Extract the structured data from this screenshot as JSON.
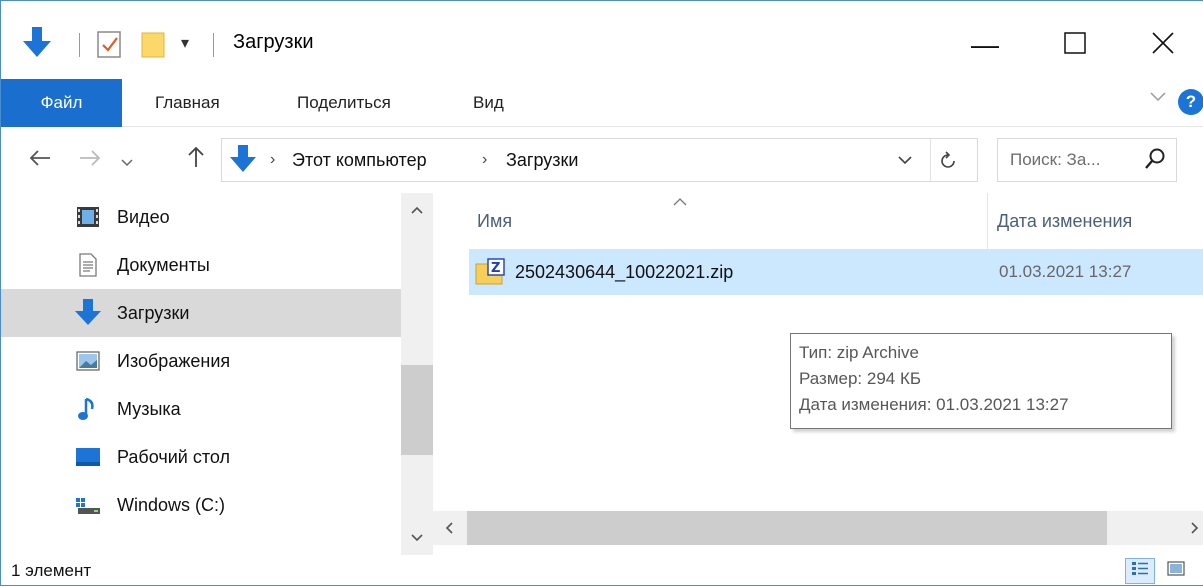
{
  "window": {
    "title": "Загрузки",
    "controls": {
      "minimize": "—",
      "maximize": "☐",
      "close": "✕"
    }
  },
  "ribbon": {
    "tabs": [
      "Файл",
      "Главная",
      "Поделиться",
      "Вид"
    ],
    "help": "?"
  },
  "address": {
    "crumbs": [
      "Этот компьютер",
      "Загрузки"
    ],
    "separator": "›",
    "search_placeholder": "Поиск: За..."
  },
  "nav": {
    "items": [
      {
        "label": "Видео",
        "icon": "video-icon"
      },
      {
        "label": "Документы",
        "icon": "documents-icon"
      },
      {
        "label": "Загрузки",
        "icon": "downloads-icon",
        "selected": true
      },
      {
        "label": "Изображения",
        "icon": "pictures-icon"
      },
      {
        "label": "Музыка",
        "icon": "music-icon"
      },
      {
        "label": "Рабочий стол",
        "icon": "desktop-icon"
      },
      {
        "label": "Windows (C:)",
        "icon": "drive-icon"
      }
    ]
  },
  "columns": {
    "name": "Имя",
    "date": "Дата изменения"
  },
  "files": [
    {
      "name": "2502430644_10022021.zip",
      "date": "01.03.2021 13:27",
      "icon": "zip-archive-icon"
    }
  ],
  "tooltip": {
    "type": "Тип: zip Archive",
    "size": "Размер: 294 КБ",
    "modified": "Дата изменения: 01.03.2021 13:27"
  },
  "status": {
    "count": "1 элемент"
  },
  "colors": {
    "accent": "#1a6fce",
    "selection": "#cce8ff",
    "nav_selected": "#d9d9d9"
  }
}
